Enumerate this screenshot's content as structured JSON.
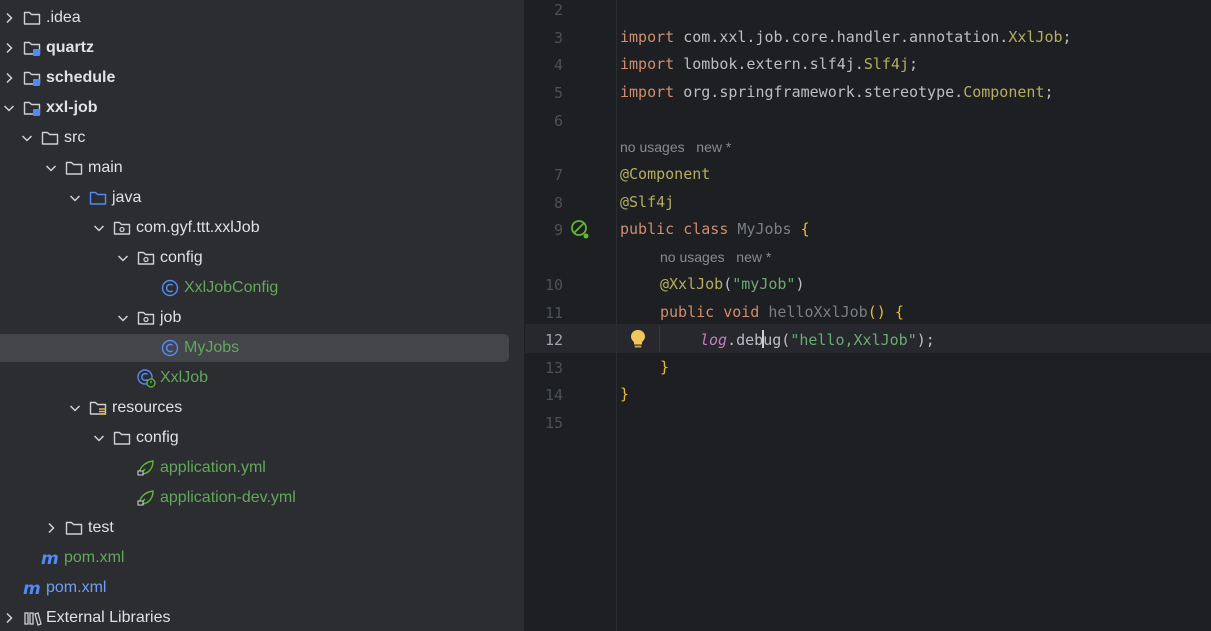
{
  "tree": {
    "rows": [
      {
        "label": ".idea",
        "chev": "right",
        "icon": "folder-icon",
        "style": "normal"
      },
      {
        "label": "quartz",
        "chev": "right",
        "icon": "module-folder-icon",
        "style": "bold"
      },
      {
        "label": "schedule",
        "chev": "right",
        "icon": "module-folder-icon",
        "style": "bold"
      },
      {
        "label": "xxl-job",
        "chev": "down",
        "icon": "module-folder-icon",
        "style": "bold"
      },
      {
        "label": "src",
        "chev": "down",
        "icon": "folder-icon",
        "style": "normal"
      },
      {
        "label": "main",
        "chev": "down",
        "icon": "folder-icon",
        "style": "normal"
      },
      {
        "label": "java",
        "chev": "down",
        "icon": "source-folder-icon",
        "style": "normal"
      },
      {
        "label": "com.gyf.ttt.xxlJob",
        "chev": "down",
        "icon": "package-icon",
        "style": "normal"
      },
      {
        "label": "config",
        "chev": "down",
        "icon": "package-icon",
        "style": "normal"
      },
      {
        "label": "XxlJobConfig",
        "chev": "none",
        "icon": "class-icon",
        "style": "green"
      },
      {
        "label": "job",
        "chev": "down",
        "icon": "package-icon",
        "style": "normal"
      },
      {
        "label": "MyJobs",
        "chev": "none",
        "icon": "class-icon",
        "style": "green"
      },
      {
        "label": "XxlJob",
        "chev": "none",
        "icon": "spring-boot-class-icon",
        "style": "green"
      },
      {
        "label": "resources",
        "chev": "down",
        "icon": "resources-folder-icon",
        "style": "normal"
      },
      {
        "label": "config",
        "chev": "down",
        "icon": "folder-icon",
        "style": "normal"
      },
      {
        "label": "application.yml",
        "chev": "none",
        "icon": "spring-yaml-icon",
        "style": "green"
      },
      {
        "label": "application-dev.yml",
        "chev": "none",
        "icon": "spring-yaml-icon",
        "style": "green"
      },
      {
        "label": "test",
        "chev": "right",
        "icon": "folder-icon",
        "style": "normal"
      },
      {
        "label": "pom.xml",
        "chev": "none",
        "icon": "maven-icon",
        "style": "green"
      },
      {
        "label": "pom.xml",
        "chev": "none",
        "icon": "maven-icon",
        "style": "blue"
      },
      {
        "label": "External Libraries",
        "chev": "right",
        "icon": "libraries-icon",
        "style": "normal"
      }
    ],
    "selected_label": "MyJobs"
  },
  "editor": {
    "line_numbers": [
      "2",
      "3",
      "4",
      "5",
      "6",
      "7",
      "8",
      "9",
      "10",
      "11",
      "12",
      "13",
      "14",
      "15"
    ],
    "active_line": "12",
    "code": {
      "import1": {
        "kw": "import",
        "path": "com.xxl.job.core.handler.annotation.",
        "cls": "XxlJob",
        "end": ";"
      },
      "import2": {
        "kw": "import",
        "path": "lombok.extern.slf4j.",
        "cls": "Slf4j",
        "end": ";"
      },
      "import3": {
        "kw": "import",
        "path": "org.springframework.stereotype.",
        "cls": "Component",
        "end": ";"
      },
      "hint1": {
        "usages": "no usages",
        "author": "new *"
      },
      "ann_component": "@Component",
      "ann_slf4j": "@Slf4j",
      "class_decl": {
        "kw1": "public",
        "kw2": "class",
        "name": "MyJobs",
        "brace": "{"
      },
      "hint2": {
        "usages": "no usages",
        "author": "new *"
      },
      "ann_xxljob": {
        "name": "@XxlJob",
        "open": "(",
        "arg": "\"myJob\"",
        "close": ")"
      },
      "method_decl": {
        "kw1": "public",
        "kw2": "void",
        "name": "helloXxlJob",
        "parens": "()",
        "brace": "{"
      },
      "log_stmt": {
        "field": "log",
        "dot": ".",
        "method_a": "deb",
        "method_b": "ug",
        "open": "(",
        "arg": "\"hello,XxlJob\"",
        "close": ")",
        "end": ";"
      },
      "close_method": "}",
      "close_class": "}"
    }
  }
}
